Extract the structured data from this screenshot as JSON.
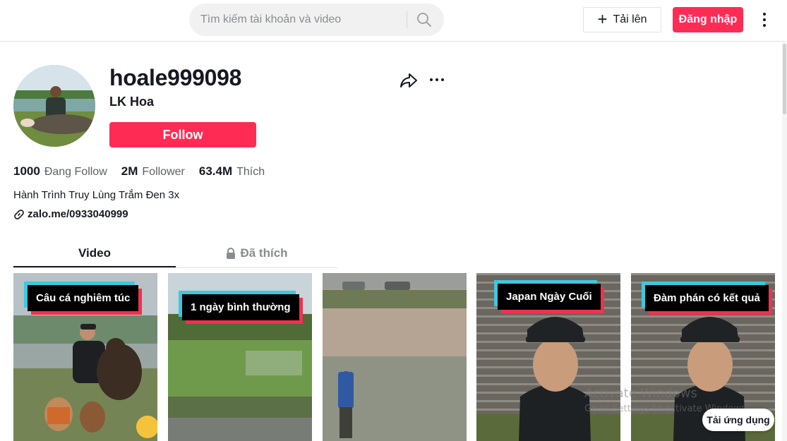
{
  "header": {
    "search_placeholder": "Tìm kiếm tài khoản và video",
    "upload_label": "Tải lên",
    "login_label": "Đăng nhập"
  },
  "profile": {
    "username": "hoale999098",
    "nickname": "LK Hoa",
    "follow_label": "Follow",
    "stats": [
      {
        "value": "1000",
        "label": "Đang Follow"
      },
      {
        "value": "2M",
        "label": "Follower"
      },
      {
        "value": "63.4M",
        "label": "Thích"
      }
    ],
    "bio": "Hành Trình Truy Lùng Trắm Đen 3x",
    "link": "zalo.me/0933040999"
  },
  "tabs": [
    {
      "label": "Video",
      "active": true
    },
    {
      "label": "Đã thích",
      "locked": true
    }
  ],
  "videos": [
    {
      "caption": "Câu cá nghiêm túc"
    },
    {
      "caption": "1 ngày bình thường"
    },
    {
      "caption": ""
    },
    {
      "caption": "Japan Ngày Cuối"
    },
    {
      "caption": "Đàm phán có kết quả"
    }
  ],
  "overlay": {
    "watermark_title": "Activate Windows",
    "watermark_sub": "Go to Settings to activate Windows.",
    "get_app_label": "Tải ứng dụng"
  },
  "colors": {
    "brand": "#fe2c55",
    "caption_cyan": "#3cc9dd",
    "caption_red": "#f0314f"
  }
}
